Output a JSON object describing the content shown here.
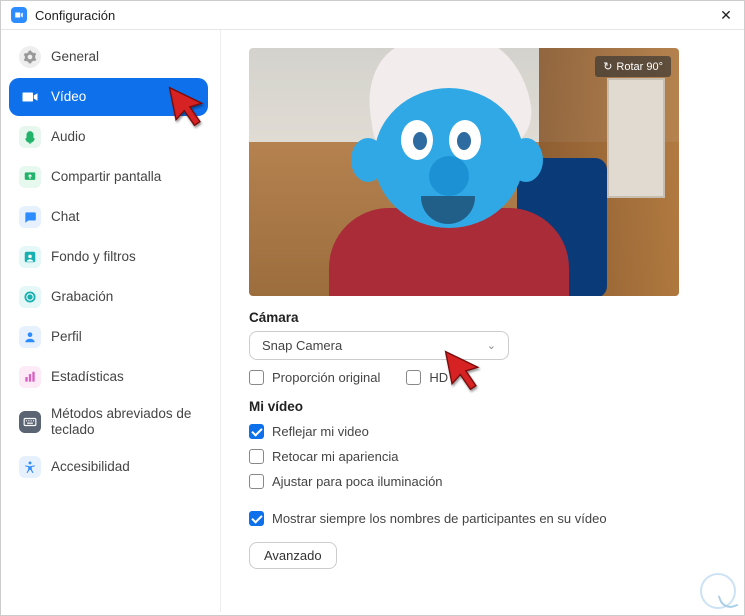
{
  "titlebar": {
    "title": "Configuración"
  },
  "sidebar": {
    "items": [
      {
        "label": "General"
      },
      {
        "label": "Vídeo"
      },
      {
        "label": "Audio"
      },
      {
        "label": "Compartir pantalla"
      },
      {
        "label": "Chat"
      },
      {
        "label": "Fondo y filtros"
      },
      {
        "label": "Grabación"
      },
      {
        "label": "Perfil"
      },
      {
        "label": "Estadísticas"
      },
      {
        "label": "Métodos abreviados de teclado"
      },
      {
        "label": "Accesibilidad"
      }
    ]
  },
  "preview": {
    "rotate_label": "Rotar 90°"
  },
  "camera": {
    "section_label": "Cámara",
    "selected": "Snap Camera",
    "original_ratio_label": "Proporción original",
    "hd_label": "HD"
  },
  "my_video": {
    "section_label": "Mi vídeo",
    "mirror_label": "Reflejar mi video",
    "touchup_label": "Retocar mi apariencia",
    "lowlight_label": "Ajustar para poca iluminación",
    "show_names_label": "Mostrar siempre los nombres de participantes en su vídeo"
  },
  "advanced_label": "Avanzado"
}
